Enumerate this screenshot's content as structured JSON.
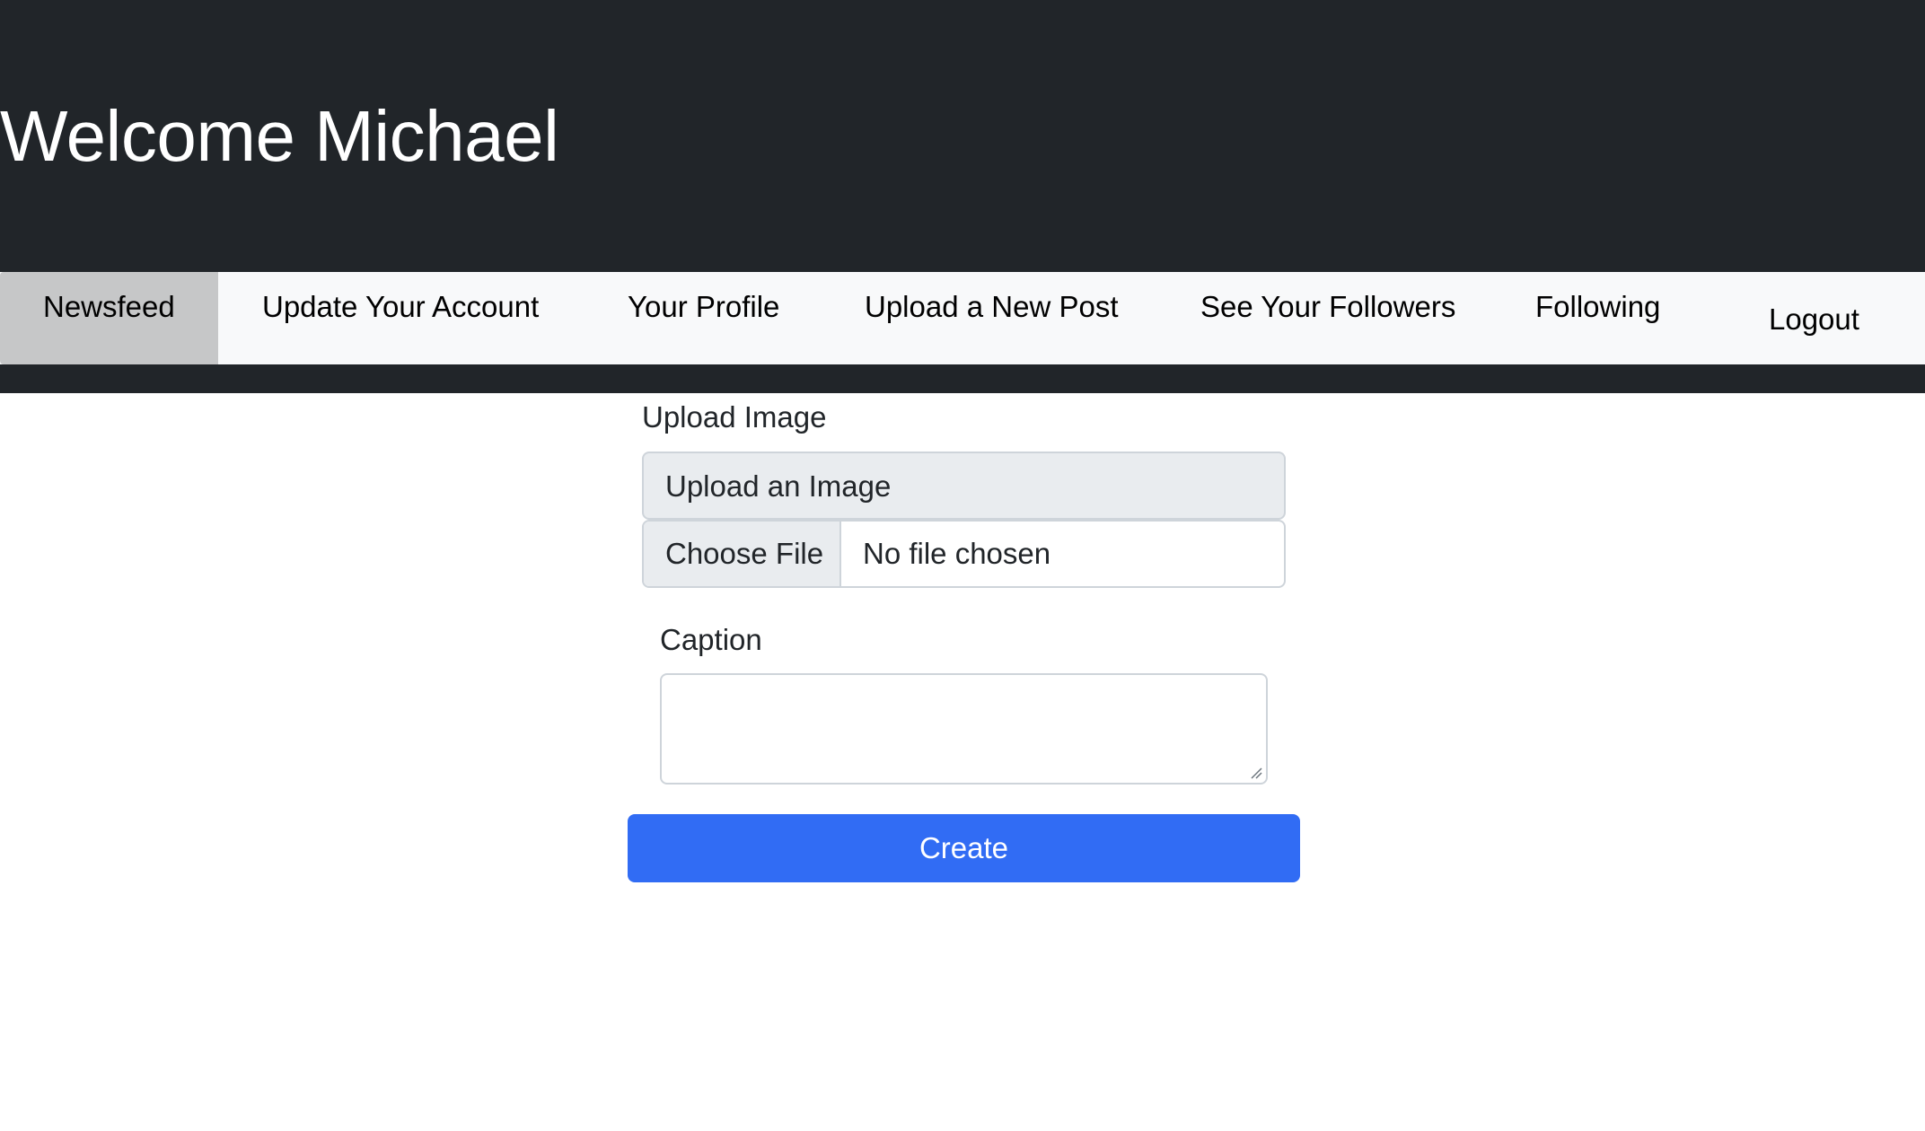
{
  "header": {
    "title": "Welcome Michael"
  },
  "nav": {
    "items": [
      {
        "label": "Newsfeed",
        "active": true
      },
      {
        "label": "Update Your Account",
        "active": false
      },
      {
        "label": "Your Profile",
        "active": false
      },
      {
        "label": "Upload a New Post",
        "active": false
      },
      {
        "label": "See Your Followers",
        "active": false
      },
      {
        "label": "Following",
        "active": false
      }
    ],
    "logout_label": "Logout"
  },
  "form": {
    "upload_label": "Upload Image",
    "upload_group_text": "Upload an Image",
    "file_button_label": "Choose File",
    "file_status": "No file chosen",
    "caption_label": "Caption",
    "caption_value": "",
    "submit_label": "Create"
  },
  "colors": {
    "header_bg": "#212529",
    "nav_bg": "#f8f9fa",
    "nav_active_bg": "#c6c7c8",
    "primary_button": "#316cf4"
  }
}
